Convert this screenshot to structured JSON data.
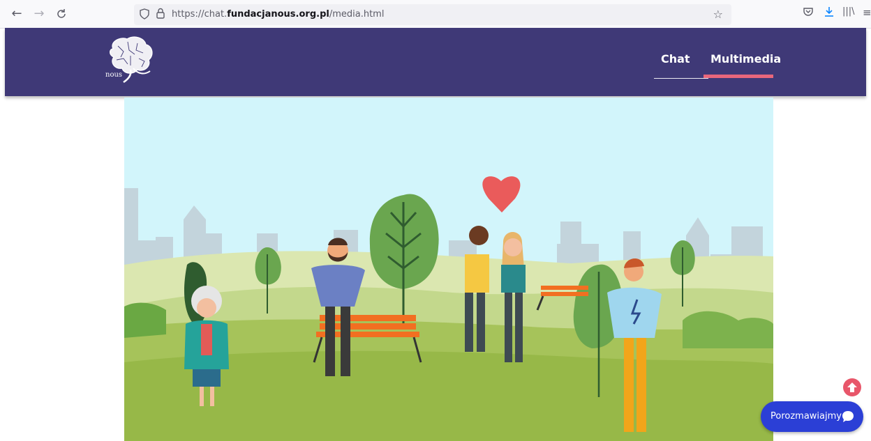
{
  "browser": {
    "url_prefix": "https://chat.",
    "url_domain": "fundacjanous.org.pl",
    "url_path": "/media.html",
    "back_glyph": "←",
    "forward_glyph": "→",
    "reload_glyph": "C",
    "shield_glyph": "◯",
    "lock_glyph": "🔒",
    "star_glyph": "☆",
    "pocket_glyph": "⛉",
    "download_glyph": "⭳",
    "library_glyph": "|||\\",
    "menu_glyph": "≡"
  },
  "site": {
    "logo_text": "nous",
    "nav": [
      {
        "label": "Chat",
        "active": false
      },
      {
        "label": "Multimedia",
        "active": true
      }
    ],
    "accent_color": "#e8677c",
    "header_color": "#3f3977"
  },
  "media": {
    "description": "animated park illustration video frame"
  },
  "widgets": {
    "chat_button_label": "Porozmawiajmy",
    "chat_button_color": "#2b3fd6",
    "scroll_top_color": "#e8566a"
  }
}
